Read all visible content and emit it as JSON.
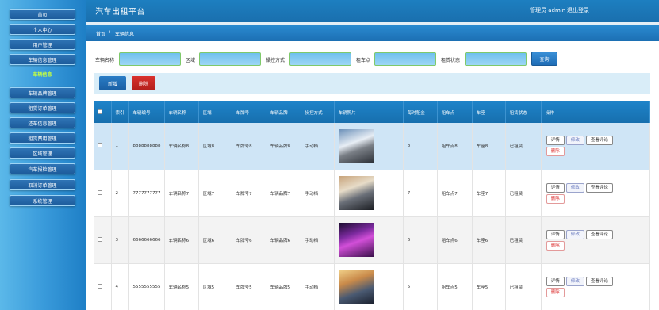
{
  "app": {
    "title": "汽车出租平台"
  },
  "header": {
    "user_text": "管理员 admin",
    "logout_label": "退出登录"
  },
  "sidebar": {
    "items": [
      {
        "label": "首页"
      },
      {
        "label": "个人中心"
      },
      {
        "label": "用户管理"
      },
      {
        "label": "车辆信息管理"
      },
      {
        "label": "车辆信息"
      },
      {
        "label": "车辆品牌管理"
      },
      {
        "label": "租赁订单管理"
      },
      {
        "label": "还车信息管理"
      },
      {
        "label": "租赁费用管理"
      },
      {
        "label": "区域管理"
      },
      {
        "label": "汽车报检管理"
      },
      {
        "label": "取消订单管理"
      },
      {
        "label": "系统管理"
      }
    ]
  },
  "breadcrumb": {
    "home": "首页",
    "separator": "/",
    "current": "车辆信息"
  },
  "search": {
    "fields": [
      {
        "label": "车辆名称",
        "value": ""
      },
      {
        "label": "区域",
        "value": ""
      },
      {
        "label": "操控方式",
        "value": ""
      },
      {
        "label": "租车点",
        "value": ""
      },
      {
        "label": "租赁状态",
        "value": ""
      }
    ],
    "button_label": "查询"
  },
  "toolbar": {
    "add_label": "新增",
    "delete_label": "删除"
  },
  "table": {
    "headers": [
      "",
      "索引",
      "车辆编号",
      "车辆名称",
      "区域",
      "车牌号",
      "车辆品牌",
      "操控方式",
      "车辆照片",
      "每时租金",
      "租车点",
      "车座",
      "租赁状态",
      "操作"
    ],
    "rows": [
      {
        "index": "1",
        "code": "8888888888",
        "name": "车辆名称8",
        "area": "区域8",
        "plate": "车牌号8",
        "brand": "车辆品牌8",
        "control": "手动档",
        "rent": "8",
        "point": "租车点8",
        "seat": "车座8",
        "status": "已租赁"
      },
      {
        "index": "2",
        "code": "7777777777",
        "name": "车辆名称7",
        "area": "区域7",
        "plate": "车牌号7",
        "brand": "车辆品牌7",
        "control": "手动档",
        "rent": "7",
        "point": "租车点7",
        "seat": "车座7",
        "status": "已租赁"
      },
      {
        "index": "3",
        "code": "6666666666",
        "name": "车辆名称6",
        "area": "区域6",
        "plate": "车牌号6",
        "brand": "车辆品牌6",
        "control": "手动档",
        "rent": "6",
        "point": "租车点6",
        "seat": "车座6",
        "status": "已租赁"
      },
      {
        "index": "4",
        "code": "5555555555",
        "name": "车辆名称5",
        "area": "区域5",
        "plate": "车牌号5",
        "brand": "车辆品牌5",
        "control": "手动档",
        "rent": "5",
        "point": "租车点5",
        "seat": "车座5",
        "status": "已租赁"
      }
    ],
    "actions": {
      "detail": "详情",
      "edit": "修改",
      "review": "查看评论",
      "delete": "删除"
    }
  }
}
